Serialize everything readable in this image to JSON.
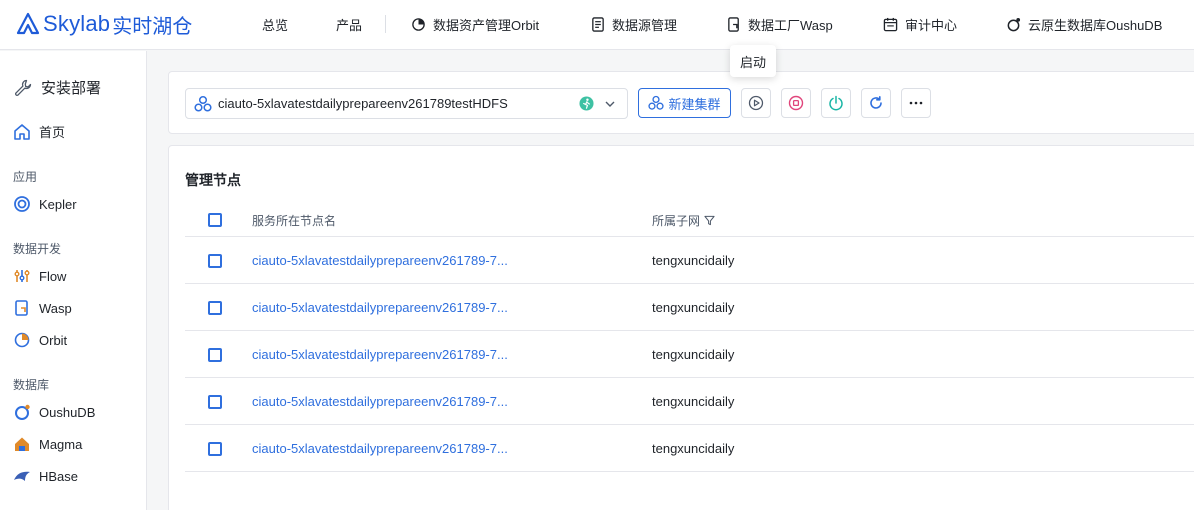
{
  "brand": {
    "name": "Skylab",
    "suffix": "实时湖仓"
  },
  "top_nav": [
    {
      "label": "总览"
    },
    {
      "label": "产品"
    },
    {
      "label": "数据资产管理Orbit"
    },
    {
      "label": "数据源管理"
    },
    {
      "label": "数据工厂Wasp"
    },
    {
      "label": "审计中心"
    },
    {
      "label": "云原生数据库OushuDB"
    }
  ],
  "tooltip": {
    "text": "启动"
  },
  "sidebar": {
    "title": "安装部署",
    "home": "首页",
    "groups": [
      {
        "label": "应用",
        "items": [
          "Kepler"
        ]
      },
      {
        "label": "数据开发",
        "items": [
          "Flow",
          "Wasp",
          "Orbit"
        ]
      },
      {
        "label": "数据库",
        "items": [
          "OushuDB",
          "Magma",
          "HBase"
        ]
      }
    ]
  },
  "toolbar": {
    "cluster_name": "ciauto-5xlavatestdailyprepareenv261789testHDFS",
    "new_cluster_label": "新建集群",
    "buttons": [
      "play-icon",
      "stop-icon",
      "power-icon",
      "refresh-icon",
      "more-icon"
    ]
  },
  "main": {
    "title": "管理节点",
    "columns": {
      "node": "服务所在节点名",
      "subnet": "所属子网"
    },
    "rows": [
      {
        "node": "ciauto-5xlavatestdailyprepareenv261789-7...",
        "subnet": "tengxuncidaily"
      },
      {
        "node": "ciauto-5xlavatestdailyprepareenv261789-7...",
        "subnet": "tengxuncidaily"
      },
      {
        "node": "ciauto-5xlavatestdailyprepareenv261789-7...",
        "subnet": "tengxuncidaily"
      },
      {
        "node": "ciauto-5xlavatestdailyprepareenv261789-7...",
        "subnet": "tengxuncidaily"
      },
      {
        "node": "ciauto-5xlavatestdailyprepareenv261789-7...",
        "subnet": "tengxuncidaily"
      }
    ]
  },
  "colors": {
    "primary": "#2f6fde",
    "brand": "#1e5bd8",
    "stop": "#e0457b",
    "power": "#19b5a5",
    "status": "#3ec1a3"
  }
}
